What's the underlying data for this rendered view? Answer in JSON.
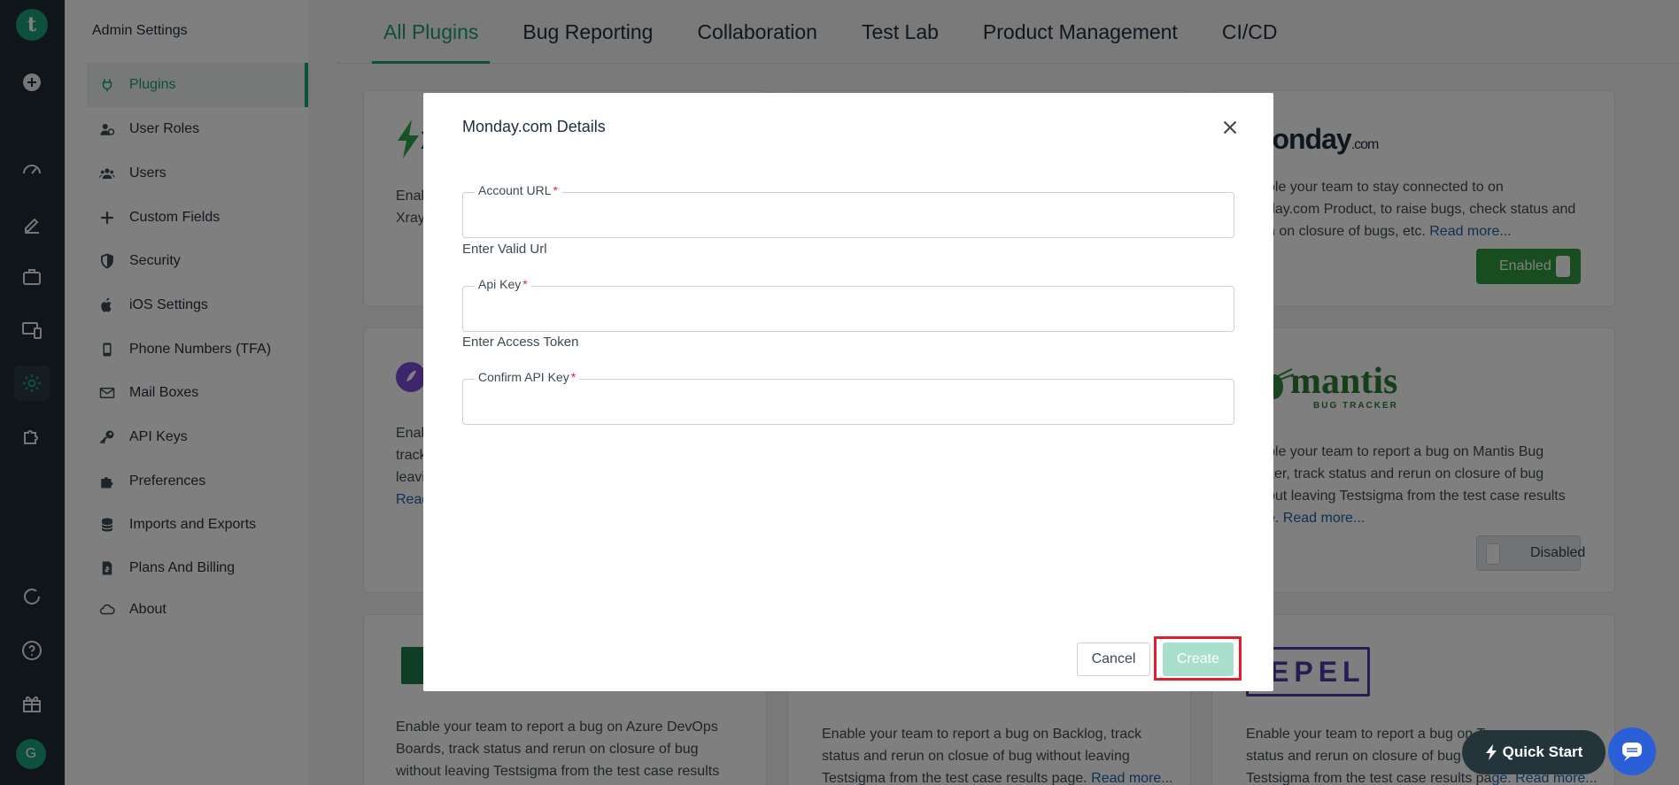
{
  "app": {
    "logo_letter": "t",
    "user_initial": "G"
  },
  "sidebar": {
    "title": "Admin Settings",
    "items": [
      {
        "label": "Plugins"
      },
      {
        "label": "User Roles"
      },
      {
        "label": "Users"
      },
      {
        "label": "Custom Fields"
      },
      {
        "label": "Security"
      },
      {
        "label": "iOS Settings"
      },
      {
        "label": "Phone Numbers (TFA)"
      },
      {
        "label": "Mail Boxes"
      },
      {
        "label": "API Keys"
      },
      {
        "label": "Preferences"
      },
      {
        "label": "Imports and Exports"
      },
      {
        "label": "Plans And Billing"
      },
      {
        "label": "About"
      }
    ]
  },
  "tabs": [
    "All Plugins",
    "Bug Reporting",
    "Collaboration",
    "Test Lab",
    "Product Management",
    "CI/CD"
  ],
  "cards": {
    "xray": {
      "text1": "Enab",
      "text2": "Xray",
      "logo_letter": "X"
    },
    "monday": {
      "logo_text": "monday",
      "logo_suffix": ".com",
      "line1": "ble your team to stay connected to on",
      "line2": "day.com Product, to raise bugs, check status and",
      "line3": "n on closure of bugs, etc.",
      "read_more": "Read more...",
      "toggle": "Enabled"
    },
    "rocket": {
      "l1": "Enab",
      "l2": "track",
      "l3": "leavi",
      "l4": "Read"
    },
    "mantis": {
      "logo_text": "mantis",
      "logo_sub": "BUG TRACKER",
      "line1": "ble your team to report a bug on Mantis Bug",
      "line2": "ker, track status and rerun on closure of bug",
      "line3": "out leaving Testsigma from the test case results",
      "line4": "e.",
      "read_more": "Read more...",
      "toggle": "Disabled"
    },
    "azure": {
      "line1": "Enable your team to report a bug on Azure DevOps",
      "line2": "Boards, track status and rerun on closure of bug",
      "line3": "without leaving Testsigma from the test case results"
    },
    "backlog": {
      "line1": "Enable your team to report a bug on Backlog, track",
      "line2": "status and rerun on closue of bug without leaving",
      "line3": "Testsigma from the test case results page.",
      "read_more": "Read more..."
    },
    "trello": {
      "logo_text": "EPEL",
      "line1": "Enable your team to report a bug on",
      "line1b": "Tr",
      "line2": "status and rerun on closure of bug w",
      "line3": "Testsigma from the test case results pa",
      "read_more": "ge. Read more..."
    }
  },
  "modal": {
    "title": "Monday.com Details",
    "fields": [
      {
        "label": "Account URL",
        "required_mark": "*",
        "value": "",
        "hint": "Enter Valid Url"
      },
      {
        "label": "Api Key",
        "required_mark": "*",
        "value": "",
        "hint": "Enter Access Token"
      },
      {
        "label": "Confirm API Key",
        "required_mark": "*",
        "value": "",
        "hint": ""
      }
    ],
    "cancel_label": "Cancel",
    "create_label": "Create"
  },
  "quick_start": "Quick Start",
  "colors": {
    "accent": "#1a9f73",
    "enabled": "#2e9a3e",
    "highlight": "#e01f2c",
    "rail": "#1f2a30"
  }
}
